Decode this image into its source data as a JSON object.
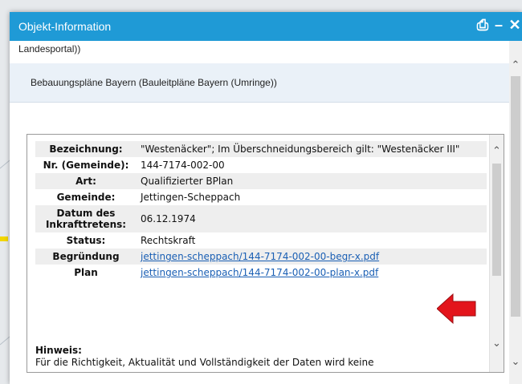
{
  "window": {
    "title": "Objekt-Information"
  },
  "icons": {
    "print": "print-icon",
    "minimize": "minimize-icon",
    "close": "close-icon"
  },
  "prev_text": "Landesportal))",
  "section": {
    "title": "Bebauungspläne Bayern (Bauleitpläne Bayern (Umringe))"
  },
  "table": {
    "rows": [
      {
        "key": "Bezeichnung:",
        "value": "\"Westenäcker\"; Im Überschneidungsbereich gilt: \"Westenäcker III\""
      },
      {
        "key": "Nr. (Gemeinde):",
        "value": "144-7174-002-00"
      },
      {
        "key": "Art:",
        "value": "Qualifizierter BPlan"
      },
      {
        "key": "Gemeinde:",
        "value": "Jettingen-Scheppach"
      },
      {
        "key": "Datum des Inkrafttretens:",
        "value": "06.12.1974"
      },
      {
        "key": "Status:",
        "value": "Rechtskraft"
      },
      {
        "key": "Begründung",
        "link": "jettingen-scheppach/144-7174-002-00-begr-x.pdf"
      },
      {
        "key": "Plan",
        "link": "jettingen-scheppach/144-7174-002-00-plan-x.pdf"
      }
    ]
  },
  "hint": {
    "label": "Hinweis:",
    "text": "Für die Richtigkeit, Aktualität und Vollständigkeit der Daten wird keine"
  },
  "colors": {
    "titlebar": "#1f9ad6",
    "link": "#1a5fb4",
    "arrow": "#e3141b"
  }
}
